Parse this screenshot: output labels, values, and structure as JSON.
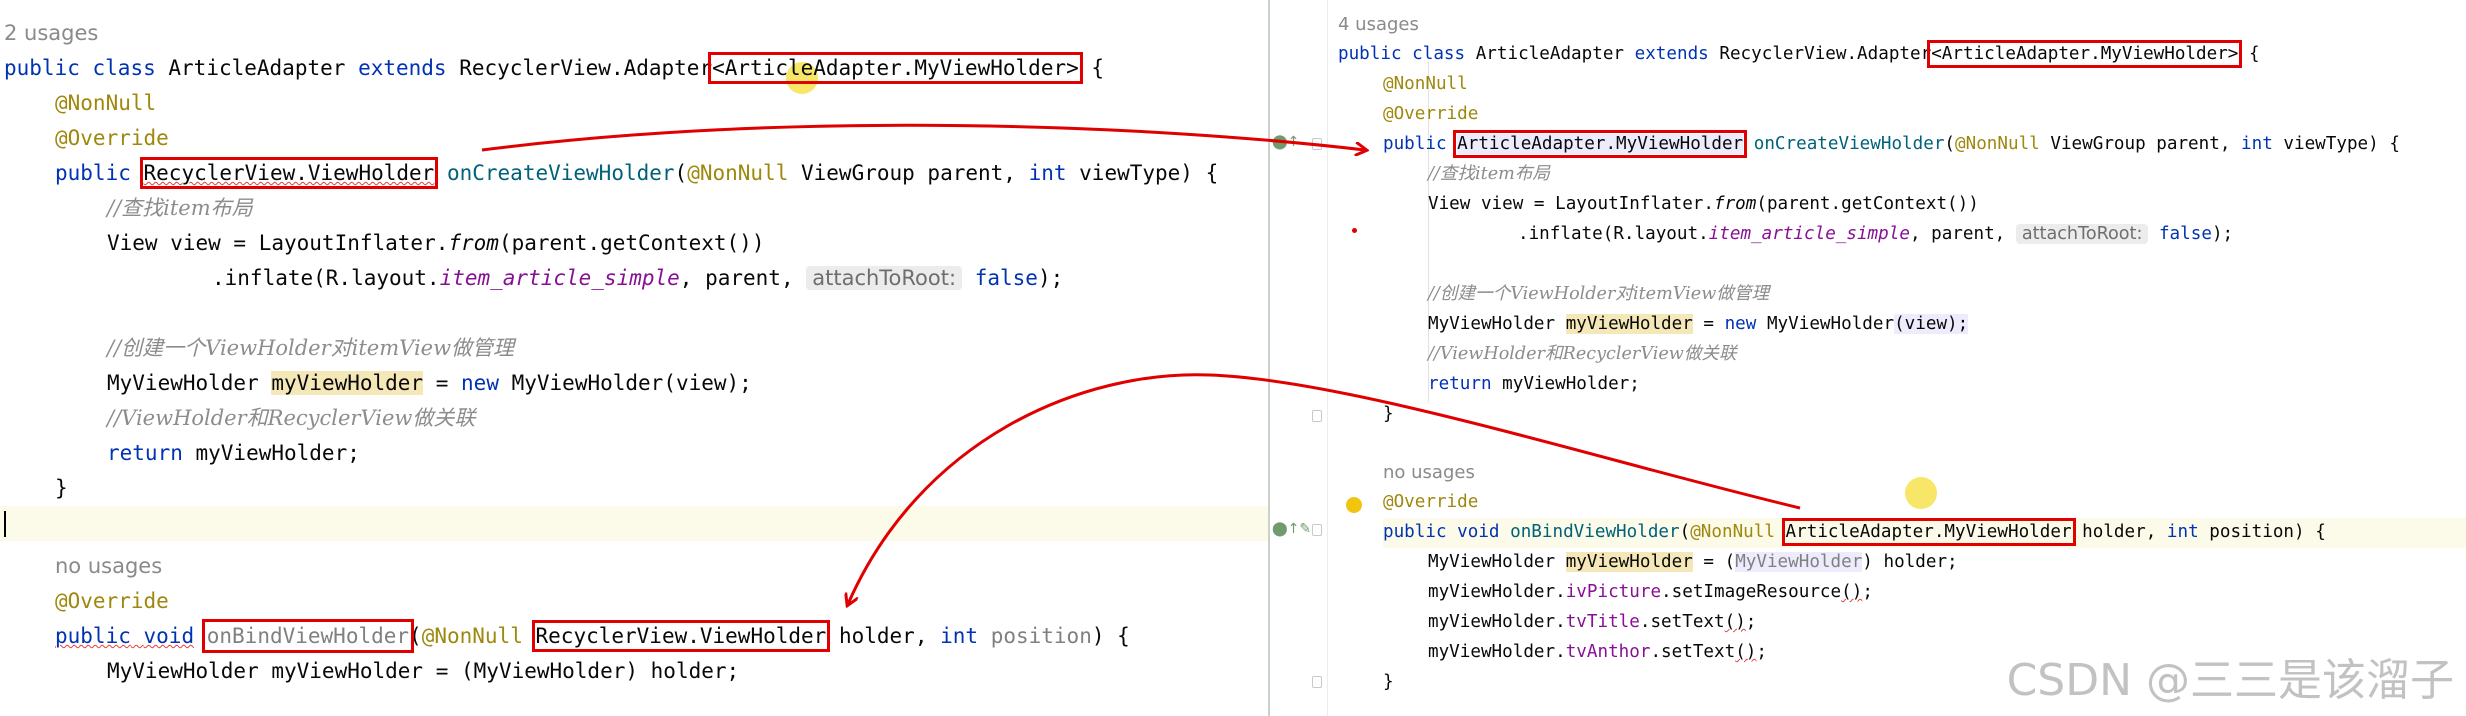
{
  "left_editor": {
    "usages": "2 usages",
    "class_decl": {
      "public_kw": "public",
      "class_kw": "class",
      "class_name": "ArticleAdapter",
      "extends_kw": "extends",
      "base": "RecyclerView.Adapter",
      "generic": "<ArticleAdapter.MyViewHolder>",
      "brace": " {"
    },
    "nonnull_annotation": "@NonNull",
    "override_annotation": "@Override",
    "create_decl": {
      "public_kw": "public",
      "return_type": "RecyclerView.ViewHolder",
      "method": "onCreateViewHolder",
      "param_annotation": "@NonNull",
      "params_a": " ViewGroup parent, ",
      "int_kw": "int",
      "params_b": " viewType) {"
    },
    "comment_find_layout": "//查找item布局",
    "view_line": {
      "prefix": "View view = LayoutInflater.",
      "method": "from",
      "suffix": "(parent.getContext())"
    },
    "inflate_line": {
      "prefix": ".inflate(R.layout.",
      "res": "item_article_simple",
      "mid": ", parent, ",
      "hint": "attachToRoot:",
      "false_kw": "false",
      "suffix": ");"
    },
    "comment_create_holder": "//创建一个ViewHolder对itemView做管理",
    "holder_line": {
      "type": "MyViewHolder ",
      "var": "myViewHolder",
      "eq": " = ",
      "new_kw": "new",
      "rest": " MyViewHolder(view);"
    },
    "comment_associate": "//ViewHolder和RecyclerView做关联",
    "return_line": {
      "return_kw": "return",
      "rest": " myViewHolder;"
    },
    "close_brace": "}",
    "bind_usages": "no usages",
    "bind_override": "@Override",
    "bind_decl": {
      "public_kw": "public",
      "void_kw": "void",
      "method": "onBindViewHolder",
      "paren": "(",
      "param_annotation": "@NonNull",
      "param_type": "RecyclerView.ViewHolder",
      "holder_param": " holder, ",
      "int_kw": "int",
      "position_param": "position",
      "end": ") {"
    },
    "bind_body_line": "MyViewHolder myViewHolder = (MyViewHolder) holder;"
  },
  "right_editor": {
    "usages": "4 usages",
    "class_decl": {
      "public_kw": "public",
      "class_kw": "class",
      "class_name": "ArticleAdapter",
      "extends_kw": "extends",
      "base": "RecyclerView.Adapter",
      "generic": "<ArticleAdapter.MyViewHolder>",
      "brace": " {"
    },
    "nonnull_annotation": "@NonNull",
    "override_annotation": "@Override",
    "create_decl": {
      "public_kw": "public",
      "return_type": "ArticleAdapter.MyViewHolder",
      "method": "onCreateViewHolder",
      "param_open": "(",
      "param_annotation": "@NonNull",
      "params_a": " ViewGroup parent, ",
      "int_kw": "int",
      "params_b": " viewType) {"
    },
    "comment_find_layout": "//查找item布局",
    "view_line": {
      "prefix": "View view = LayoutInflater.",
      "method": "from",
      "suffix": "(parent.getContext())"
    },
    "inflate_line": {
      "prefix": ".inflate(R.layout.",
      "res": "item_article_simple",
      "mid": ", parent, ",
      "hint": "attachToRoot:",
      "false_kw": "false",
      "suffix": ");"
    },
    "comment_create_holder": "//创建一个ViewHolder对itemView做管理",
    "holder_line": {
      "type": "MyViewHolder ",
      "var": "myViewHolder",
      "eq": " = ",
      "new_kw": "new",
      "rest": " MyViewHolder",
      "rest2": "(view);"
    },
    "comment_associate": "//ViewHolder和RecyclerView做关联",
    "return_line": {
      "return_kw": "return",
      "rest": " myViewHolder;"
    },
    "close_brace": "}",
    "bind_usages": "no usages",
    "bind_override": "@Override",
    "bind_decl": {
      "public_kw": "public",
      "void_kw": "void",
      "method": "onBindViewHolder",
      "param_open": "(",
      "param_annotation": "@NonNull",
      "param_type": "ArticleAdapter.MyViewHolder",
      "holder_param": " holder, ",
      "int_kw": "int",
      "position_param": " position) {"
    },
    "bind_line1": {
      "type": "MyViewHolder ",
      "var": "myViewHolder",
      "eq": " = (",
      "cast": "MyViewHolder",
      "rest": ") holder;"
    },
    "bind_line2": {
      "obj": "myViewHolder.",
      "field": "ivPicture",
      "call": ".setImageResource",
      "args": "()",
      "end": ";"
    },
    "bind_line3": {
      "obj": "myViewHolder.",
      "field": "tvTitle",
      "call": ".setText",
      "args": "()",
      "end": ";"
    },
    "bind_line4": {
      "obj": "myViewHolder.",
      "field": "tvAnthor",
      "call": ".setText",
      "args": "()",
      "end": ";"
    },
    "class_close": "}"
  },
  "watermark": "CSDN @三三是该溜子",
  "colors": {
    "keyword": "#0033b3",
    "annotation": "#9e880d",
    "comment": "#8c8c8c",
    "field": "#871094",
    "method_decl": "#00627a",
    "annotation_box": "#e00000",
    "arrow": "#e00000"
  }
}
